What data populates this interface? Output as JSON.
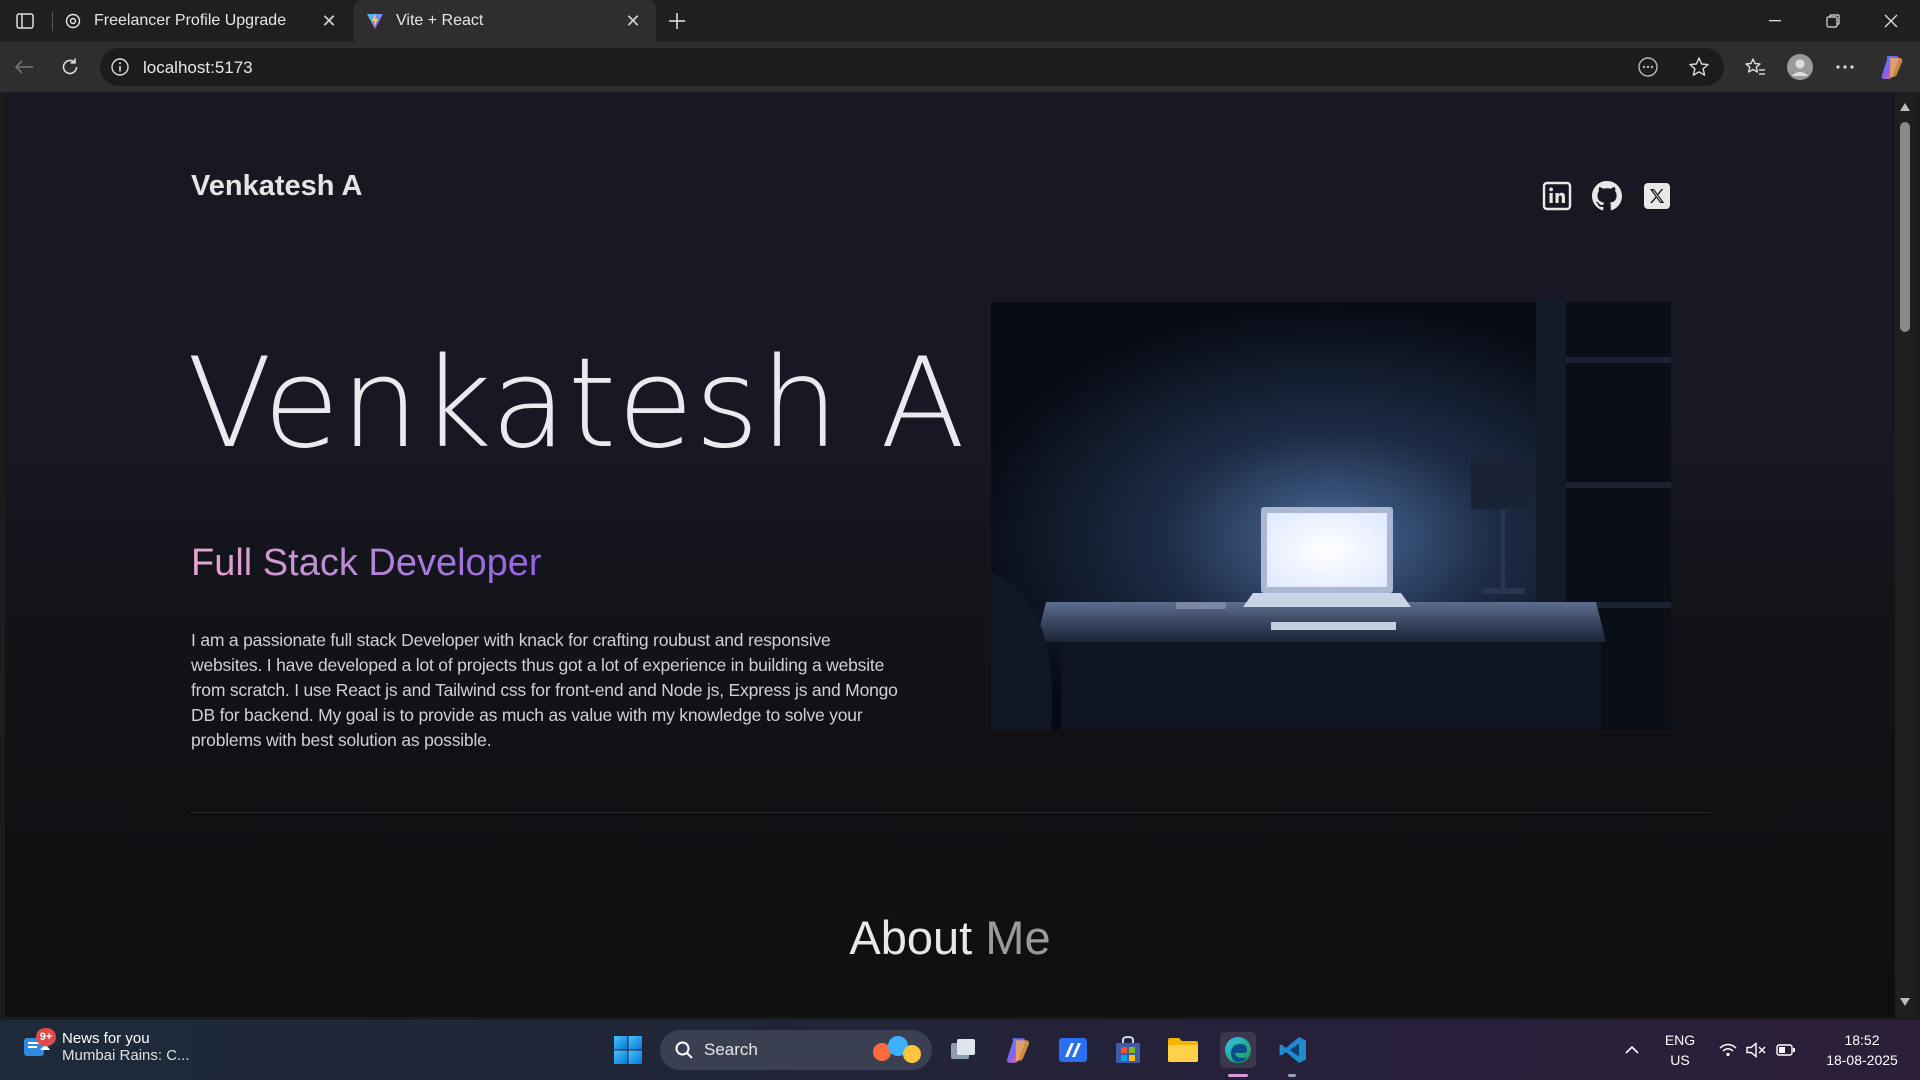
{
  "browser": {
    "tabs": [
      {
        "title": "Freelancer Profile Upgrade",
        "icon": "openai-icon",
        "active": false
      },
      {
        "title": "Vite + React",
        "icon": "vite-icon",
        "active": true
      }
    ],
    "address": "localhost:5173"
  },
  "page": {
    "brand": "Venkatesh A",
    "hero_name": "Venkatesh A",
    "role": "Full Stack Developer",
    "bio": "I am a passionate full stack Developer with knack for crafting roubust and responsive websites. I have developed a lot of projects thus got a lot of experience in building a website from scratch. I use React js and Tailwind css for front-end and Node js, Express js and Mongo DB for backend. My goal is to provide as much as value with my knowledge to solve your problems with best solution as possible.",
    "about_title_main": "About",
    "about_title_dim": "Me",
    "social": [
      "linkedin-icon",
      "github-icon",
      "x-icon"
    ]
  },
  "taskbar": {
    "news_badge": "9+",
    "news_title": "News for you",
    "news_sub": "Mumbai Rains: C...",
    "search_label": "Search",
    "lang_line1": "ENG",
    "lang_line2": "US",
    "time": "18:52",
    "date": "18-08-2025"
  },
  "colors": {
    "role_gradient_start": "#e8a6cf",
    "role_gradient_end": "#9161e5",
    "page_bg": "#14141a"
  }
}
